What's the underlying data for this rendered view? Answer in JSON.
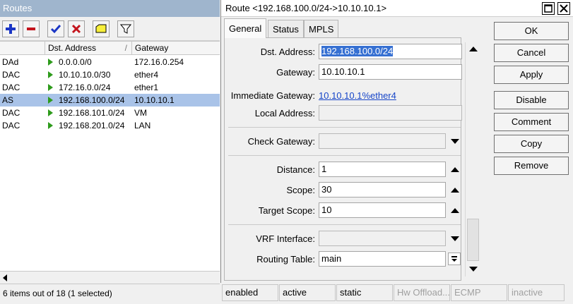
{
  "routes_window": {
    "title": "Routes",
    "columns": {
      "flags": "",
      "dst": "Dst. Address",
      "gateway": "Gateway"
    },
    "rows": [
      {
        "flags": "DAd",
        "dst": "0.0.0.0/0",
        "gateway": "172.16.0.254",
        "selected": false
      },
      {
        "flags": "DAC",
        "dst": "10.10.10.0/30",
        "gateway": "ether4",
        "selected": false
      },
      {
        "flags": "DAC",
        "dst": "172.16.0.0/24",
        "gateway": "ether1",
        "selected": false
      },
      {
        "flags": "AS",
        "dst": "192.168.100.0/24",
        "gateway": "10.10.10.1",
        "selected": true
      },
      {
        "flags": "DAC",
        "dst": "192.168.101.0/24",
        "gateway": "VM",
        "selected": false
      },
      {
        "flags": "DAC",
        "dst": "192.168.201.0/24",
        "gateway": "LAN",
        "selected": false
      }
    ],
    "status": "6 items out of 18 (1 selected)",
    "sort_indicator": "/"
  },
  "route_window": {
    "title": "Route <192.168.100.0/24->10.10.10.1>",
    "tabs": [
      "General",
      "Status",
      "MPLS"
    ],
    "active_tab": "General",
    "fields": {
      "dst_address": {
        "label": "Dst. Address:",
        "value": "192.168.100.0/24"
      },
      "gateway": {
        "label": "Gateway:",
        "value": "10.10.10.1"
      },
      "immediate_gateway": {
        "label": "Immediate Gateway:",
        "value": "10.10.10.1%ether4"
      },
      "local_address": {
        "label": "Local Address:",
        "value": ""
      },
      "check_gateway": {
        "label": "Check Gateway:",
        "value": ""
      },
      "distance": {
        "label": "Distance:",
        "value": "1"
      },
      "scope": {
        "label": "Scope:",
        "value": "30"
      },
      "target_scope": {
        "label": "Target Scope:",
        "value": "10"
      },
      "vrf_interface": {
        "label": "VRF Interface:",
        "value": ""
      },
      "routing_table": {
        "label": "Routing Table:",
        "value": "main"
      }
    },
    "buttons": {
      "ok": "OK",
      "cancel": "Cancel",
      "apply": "Apply",
      "disable": "Disable",
      "comment": "Comment",
      "copy": "Copy",
      "remove": "Remove"
    },
    "status_bar": [
      "enabled",
      "active",
      "static",
      "Hw Offload...",
      "ECMP",
      "inactive"
    ]
  },
  "colors": {
    "accent_selection": "#a9c3e8",
    "highlight": "#3670d2",
    "link": "#1645c8",
    "route_arrow": "#2e9b1c",
    "add_icon": "#1b36c5",
    "remove_icon": "#c3141c"
  },
  "icons": [
    "plus-icon",
    "minus-icon",
    "checkmark-icon",
    "cross-icon",
    "comment-icon",
    "filter-icon",
    "route-arrow-icon"
  ]
}
